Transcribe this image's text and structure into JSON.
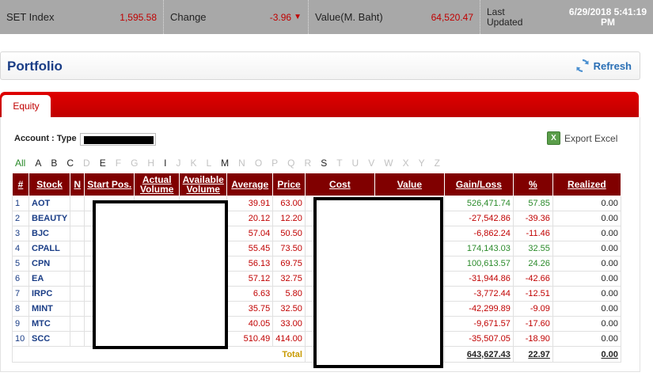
{
  "ticker": {
    "set_label": "SET Index",
    "set_value": "1,595.58",
    "change_label": "Change",
    "change_value": "-3.96",
    "value_label": "Value(M. Baht)",
    "value_value": "64,520.47",
    "updated_label_1": "Last",
    "updated_label_2": "Updated",
    "updated_value_1": "6/29/2018 5:41:19",
    "updated_value_2": "PM"
  },
  "portfolio": {
    "title": "Portfolio",
    "refresh_label": "Refresh"
  },
  "tabs": [
    {
      "label": "Equity"
    }
  ],
  "account": {
    "label": "Account : Type"
  },
  "export_label": "Export Excel",
  "alphabet": {
    "all": "All",
    "letters": [
      "A",
      "B",
      "C",
      "D",
      "E",
      "F",
      "G",
      "H",
      "I",
      "J",
      "K",
      "L",
      "M",
      "N",
      "O",
      "P",
      "Q",
      "R",
      "S",
      "T",
      "U",
      "V",
      "W",
      "X",
      "Y",
      "Z"
    ],
    "active": [
      "A",
      "B",
      "C",
      "E",
      "I",
      "M",
      "S"
    ]
  },
  "table": {
    "headers": [
      "#",
      "Stock",
      "N",
      "Start Pos.",
      "Actual Volume",
      "Available Volume",
      "Average",
      "Price",
      "Cost",
      "Value",
      "Gain/Loss",
      "%",
      "Realized"
    ],
    "rows": [
      {
        "no": "1",
        "stock": "AOT",
        "average": "39.91",
        "price": "63.00",
        "gain": "526,471.74",
        "pct": "57.85",
        "realized": "0.00",
        "sign": "pos"
      },
      {
        "no": "2",
        "stock": "BEAUTY",
        "average": "20.12",
        "price": "12.20",
        "gain": "-27,542.86",
        "pct": "-39.36",
        "realized": "0.00",
        "sign": "neg"
      },
      {
        "no": "3",
        "stock": "BJC",
        "average": "57.04",
        "price": "50.50",
        "gain": "-6,862.24",
        "pct": "-11.46",
        "realized": "0.00",
        "sign": "neg"
      },
      {
        "no": "4",
        "stock": "CPALL",
        "average": "55.45",
        "price": "73.50",
        "gain": "174,143.03",
        "pct": "32.55",
        "realized": "0.00",
        "sign": "pos"
      },
      {
        "no": "5",
        "stock": "CPN",
        "average": "56.13",
        "price": "69.75",
        "gain": "100,613.57",
        "pct": "24.26",
        "realized": "0.00",
        "sign": "pos"
      },
      {
        "no": "6",
        "stock": "EA",
        "average": "57.12",
        "price": "32.75",
        "gain": "-31,944.86",
        "pct": "-42.66",
        "realized": "0.00",
        "sign": "neg"
      },
      {
        "no": "7",
        "stock": "IRPC",
        "average": "6.63",
        "price": "5.80",
        "gain": "-3,772.44",
        "pct": "-12.51",
        "realized": "0.00",
        "sign": "neg"
      },
      {
        "no": "8",
        "stock": "MINT",
        "average": "35.75",
        "price": "32.50",
        "gain": "-42,299.89",
        "pct": "-9.09",
        "realized": "0.00",
        "sign": "neg"
      },
      {
        "no": "9",
        "stock": "MTC",
        "average": "40.05",
        "price": "33.00",
        "gain": "-9,671.57",
        "pct": "-17.60",
        "realized": "0.00",
        "sign": "neg"
      },
      {
        "no": "10",
        "stock": "SCC",
        "average": "510.49",
        "price": "414.00",
        "gain": "-35,507.05",
        "pct": "-18.90",
        "realized": "0.00",
        "sign": "neg"
      }
    ],
    "total": {
      "label": "Total",
      "gain": "643,627.43",
      "pct": "22.97",
      "realized": "0.00"
    }
  },
  "colors": {
    "brand_red": "#c00000",
    "header_maroon": "#800000",
    "positive": "#2a8a2a",
    "negative": "#c00000",
    "title_blue": "#1a3d86"
  }
}
